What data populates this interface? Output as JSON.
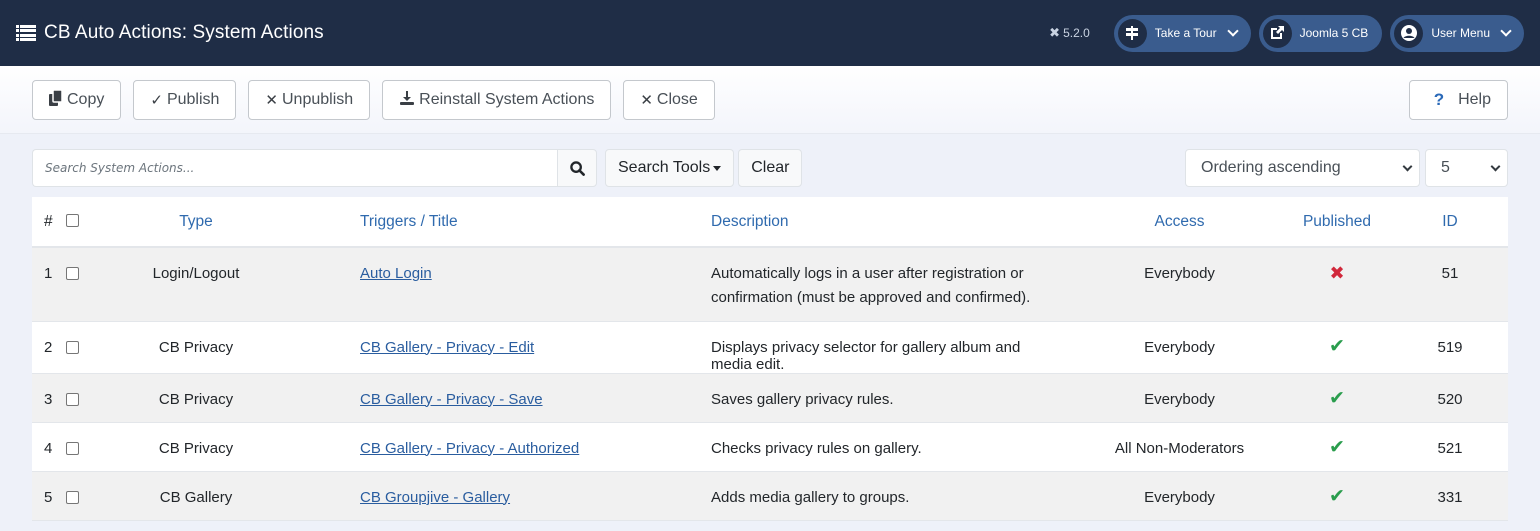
{
  "header": {
    "title": "CB Auto Actions: System Actions",
    "version": "5.2.0",
    "buttons": [
      {
        "label": "Take a Tour",
        "icon": "signpost-icon",
        "has_dropdown": true
      },
      {
        "label": "Joomla 5 CB",
        "icon": "external-link-icon",
        "has_dropdown": false
      },
      {
        "label": "User Menu",
        "icon": "user-circle-icon",
        "has_dropdown": true
      }
    ]
  },
  "toolbar": {
    "copy_label": "Copy",
    "publish_label": "Publish",
    "unpublish_label": "Unpublish",
    "reinstall_label": "Reinstall System Actions",
    "close_label": "Close",
    "help_label": "Help"
  },
  "filters": {
    "search_placeholder": "Search System Actions...",
    "search_value": "",
    "search_tools_label": "Search Tools",
    "clear_label": "Clear",
    "ordering_selected": "Ordering ascending",
    "limit_selected": "5"
  },
  "table": {
    "columns": {
      "num": "#",
      "type": "Type",
      "title": "Triggers / Title",
      "description": "Description",
      "access": "Access",
      "published": "Published",
      "id": "ID"
    },
    "rows": [
      {
        "num": "1",
        "type": "Login/Logout",
        "title": "Auto Login",
        "description": "Automatically logs in a user after registration or confirmation (must be approved and confirmed).",
        "access": "Everybody",
        "published": false,
        "id": "51"
      },
      {
        "num": "2",
        "type": "CB Privacy",
        "title": "CB Gallery - Privacy - Edit",
        "description": "Displays privacy selector for gallery album and media edit.",
        "access": "Everybody",
        "published": true,
        "id": "519"
      },
      {
        "num": "3",
        "type": "CB Privacy",
        "title": "CB Gallery - Privacy - Save",
        "description": "Saves gallery privacy rules.",
        "access": "Everybody",
        "published": true,
        "id": "520"
      },
      {
        "num": "4",
        "type": "CB Privacy",
        "title": "CB Gallery - Privacy - Authorized",
        "description": "Checks privacy rules on gallery.",
        "access": "All Non-Moderators",
        "published": true,
        "id": "521"
      },
      {
        "num": "5",
        "type": "CB Gallery",
        "title": "CB Groupjive - Gallery",
        "description": "Adds media gallery to groups.",
        "access": "Everybody",
        "published": true,
        "id": "331"
      }
    ]
  },
  "colors": {
    "header_bg": "#1f2d46",
    "pill_bg": "#3a5c8e",
    "link": "#2a5d9f",
    "published": "#2a9d4d",
    "unpublished": "#d1283b"
  }
}
